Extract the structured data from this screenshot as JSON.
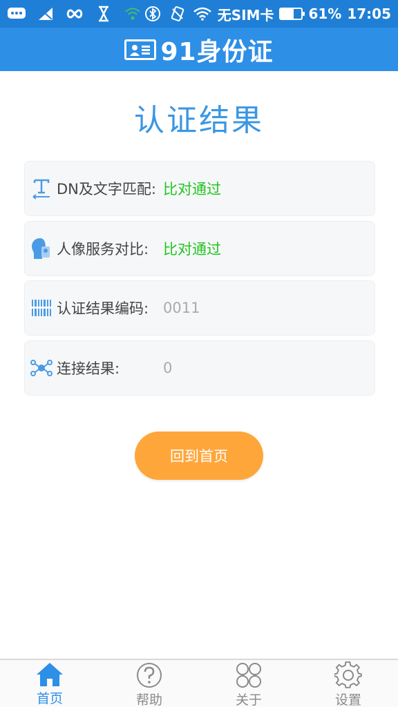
{
  "status_bar": {
    "carrier": "无SIM卡",
    "battery_percent": "61%",
    "battery_level": 0.61,
    "time": "17:05"
  },
  "app": {
    "title": "91身份证"
  },
  "result": {
    "heading": "认证结果",
    "rows": [
      {
        "icon": "text-icon",
        "label": "DN及文字匹配:",
        "value": "比对通过",
        "status": "ok"
      },
      {
        "icon": "face-icon",
        "label": "人像服务对比:",
        "value": "比对通过",
        "status": "ok"
      },
      {
        "icon": "barcode-icon",
        "label": "认证结果编码:",
        "value": "0011",
        "status": "gray"
      },
      {
        "icon": "network-icon",
        "label": "连接结果:",
        "value": "0",
        "status": "gray"
      }
    ]
  },
  "buttons": {
    "home": "回到首页"
  },
  "nav": {
    "items": [
      {
        "label": "首页",
        "icon": "home-icon",
        "active": true
      },
      {
        "label": "帮助",
        "icon": "help-icon",
        "active": false
      },
      {
        "label": "关于",
        "icon": "grid-icon",
        "active": false
      },
      {
        "label": "设置",
        "icon": "gear-icon",
        "active": false
      }
    ]
  },
  "colors": {
    "header": "#2e8fe6",
    "status_bar": "#1f7fd6",
    "accent": "#3a97e4",
    "ok": "#22c41f",
    "button": "#ffa63a"
  }
}
